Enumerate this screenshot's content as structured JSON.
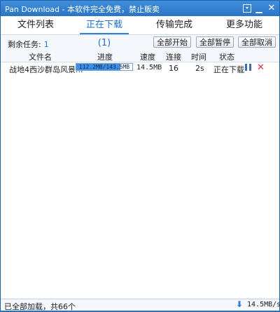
{
  "window": {
    "title": "Pan Download - 本软件完全免费，禁止贩卖"
  },
  "tabs": [
    {
      "label": "文件列表"
    },
    {
      "label": "正在下载(1)"
    },
    {
      "label": "传输完成"
    },
    {
      "label": "更多功能"
    }
  ],
  "toolbar": {
    "remaining_label": "剩余任务:",
    "remaining_count": "1",
    "start_all": "全部开始",
    "pause_all": "全部暂停",
    "cancel_all": "全部取消"
  },
  "columns": [
    "文件名",
    "进度",
    "速度",
    "连接",
    "时间",
    "状态"
  ],
  "downloads": [
    {
      "filename": "战地4西沙群岛风景...",
      "progress_text": "112.2MB/143.5MB",
      "progress_fraction": 0.782,
      "speed": "14.5MB",
      "connections": "16",
      "time": "2s",
      "status": "正在下载"
    }
  ],
  "statusbar": {
    "text": "已全部加载，共66个",
    "speed": "14.5MB/s"
  },
  "colors": {
    "accent": "#2e82dd",
    "titlebar": "#2c74c4",
    "delete": "#e0303a"
  }
}
